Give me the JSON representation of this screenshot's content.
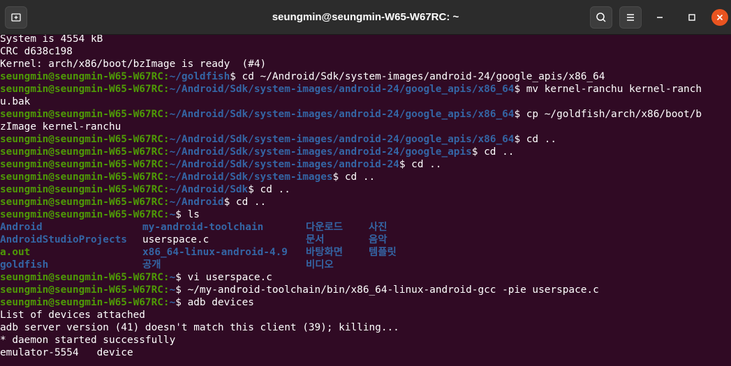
{
  "window": {
    "title": "seungmin@seungmin-W65-W67RC: ~"
  },
  "prompt": {
    "user_host": "seungmin@seungmin-W65-W67RC:"
  },
  "terminal": {
    "l1": "System is 4554 kB",
    "l2": "CRC d638c198",
    "l3": "Kernel: arch/x86/boot/bzImage is ready  (#4)",
    "l4_path": "~/goldfish",
    "l4_cmd": "$ cd ~/Android/Sdk/system-images/android-24/google_apis/x86_64",
    "l5_path": "~/Android/Sdk/system-images/android-24/google_apis/x86_64",
    "l5_cmd": "$ mv kernel-ranchu kernel-ranch",
    "l6": "u.bak",
    "l7_path": "~/Android/Sdk/system-images/android-24/google_apis/x86_64",
    "l7_cmd": "$ cp ~/goldfish/arch/x86/boot/b",
    "l8": "zImage kernel-ranchu",
    "l9_path": "~/Android/Sdk/system-images/android-24/google_apis/x86_64",
    "l9_cmd": "$ cd ..",
    "l10_path": "~/Android/Sdk/system-images/android-24/google_apis",
    "l10_cmd": "$ cd ..",
    "l11_path": "~/Android/Sdk/system-images/android-24",
    "l11_cmd": "$ cd ..",
    "l12_path": "~/Android/Sdk/system-images",
    "l12_cmd": "$ cd ..",
    "l13_path": "~/Android/Sdk",
    "l13_cmd": "$ cd ..",
    "l14_path": "~/Android",
    "l14_cmd": "$ cd ..",
    "l15_path": "~",
    "l15_cmd": "$ ls",
    "ls_rows": [
      [
        "Android",
        "my-android-toolchain",
        "다운로드",
        "사진"
      ],
      [
        "AndroidStudioProjects",
        "userspace.c",
        "문서",
        "음악"
      ],
      [
        "a.out",
        "x86_64-linux-android-4.9",
        "바탕화면",
        "템플릿"
      ],
      [
        "goldfish",
        "공개",
        "비디오",
        ""
      ]
    ],
    "l20_path": "~",
    "l20_cmd": "$ vi userspace.c",
    "l21_path": "~",
    "l21_cmd": "$ ~/my-android-toolchain/bin/x86_64-linux-android-gcc -pie userspace.c",
    "l22_path": "~",
    "l22_cmd": "$ adb devices",
    "l23": "List of devices attached",
    "l24": "adb server version (41) doesn't match this client (39); killing...",
    "l25": "* daemon started successfully",
    "l26": "emulator-5554\tdevice"
  },
  "icons": {
    "new_tab": "new-tab-icon",
    "search": "search-icon",
    "menu": "hamburger-menu-icon",
    "minimize": "minimize-icon",
    "maximize": "maximize-icon",
    "close": "close-icon"
  },
  "colors": {
    "background": "#300a24",
    "prompt_user": "#4e9a06",
    "prompt_path": "#3465a4",
    "close": "#e95420"
  }
}
